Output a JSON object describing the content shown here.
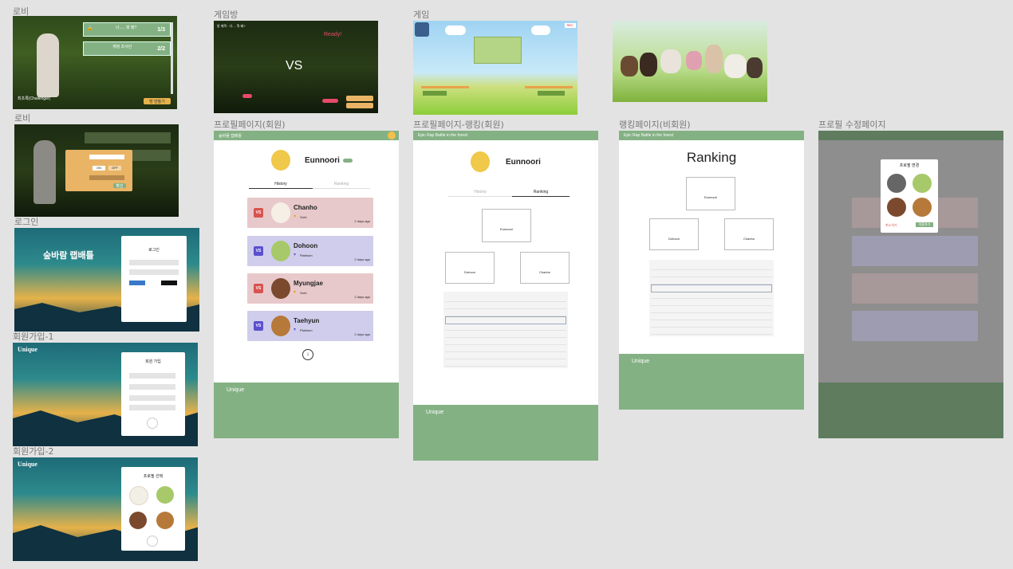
{
  "labels": {
    "lobby1": "로비",
    "lobby2": "로비",
    "login": "로그인",
    "signup1": "회원가입-1",
    "signup2": "회원가입-2",
    "gameroom": "게임방",
    "game": "게임",
    "profile_member": "프로필페이지(회원)",
    "profile_ranking": "프로필페이지-랭킹(회원)",
    "ranking_guest": "랭킹페이지(비회원)",
    "profile_edit": "프로필 수정페이지"
  },
  "lobby": {
    "rooms": [
      {
        "title": "너..... 뭐 돼?",
        "count": "1/3"
      },
      {
        "title": "계정 조사단",
        "count": "2/2"
      }
    ],
    "player_name": "최초록(Challenger)",
    "make_room": "방 만들기"
  },
  "lobby_modal": {
    "confirm": "확인",
    "on": "ON",
    "off": "OFF"
  },
  "login": {
    "brand": "숲바람 랩배틀",
    "title": "로그인"
  },
  "signup": {
    "brand": "Unique",
    "title": "회원 가입"
  },
  "signup2": {
    "brand": "Unique",
    "title": "프로필 선택"
  },
  "gameroom": {
    "vs": "VS",
    "ready": "Ready!",
    "title": "방 제목 : 너.... 뭐 돼?"
  },
  "game": {
    "rec": "REC"
  },
  "profile": {
    "nav_title": "숲바람 랩배틀",
    "username": "Eunnoori",
    "tabs": [
      "History",
      "Ranking"
    ],
    "history": [
      {
        "name": "Chanho",
        "tier": "Gold",
        "ago": "2 days ago",
        "color": "#e8c9cb"
      },
      {
        "name": "Dohoon",
        "tier": "Platinum",
        "ago": "2 days ago",
        "color": "#cfcdeb"
      },
      {
        "name": "Myungjae",
        "tier": "Gold",
        "ago": "2 days ago",
        "color": "#e8c9cb"
      },
      {
        "name": "Taehyun",
        "tier": "Platinum",
        "ago": "2 days ago",
        "color": "#cfcdeb"
      }
    ],
    "footer_brand": "Unique"
  },
  "profile_ranking": {
    "nav_title": "Epic Rap Battle in the forest",
    "username": "Eunnoori",
    "podium": [
      "Eunnoori",
      "Dohoon",
      "Chanho"
    ],
    "tabs": [
      "History",
      "Ranking"
    ]
  },
  "ranking_page": {
    "nav_title": "Epic Rap Battle in the forest",
    "title": "Ranking",
    "podium": [
      "Eunnoori",
      "Dohoon",
      "Chanho"
    ]
  },
  "profile_edit": {
    "modal_title": "프로필 변경",
    "cancel": "취소하기",
    "confirm": "적용하기"
  },
  "colors": {
    "green": "#84b184",
    "lose_card": "#e8c9cb",
    "win_card": "#cfcdeb",
    "lose_badge": "#d9534f",
    "win_badge": "#5a4fcf"
  }
}
